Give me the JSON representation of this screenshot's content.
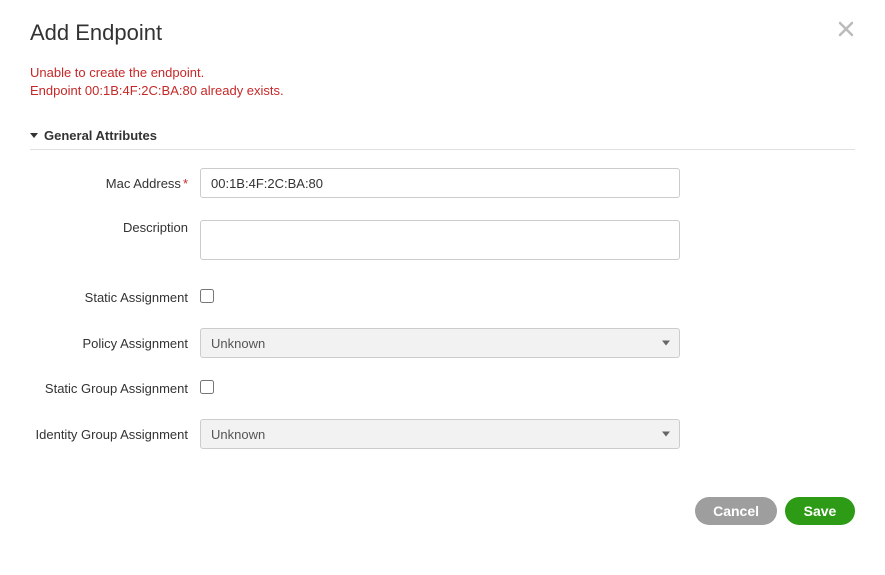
{
  "dialog": {
    "title": "Add Endpoint"
  },
  "error": {
    "line1": "Unable to create the endpoint.",
    "line2": "Endpoint 00:1B:4F:2C:BA:80 already exists."
  },
  "section": {
    "general_attributes": "General Attributes"
  },
  "labels": {
    "mac_address": "Mac Address",
    "description": "Description",
    "static_assignment": "Static Assignment",
    "policy_assignment": "Policy Assignment",
    "static_group_assignment": "Static Group Assignment",
    "identity_group_assignment": "Identity Group Assignment"
  },
  "values": {
    "mac_address": "00:1B:4F:2C:BA:80",
    "description": "",
    "static_assignment_checked": false,
    "policy_assignment": "Unknown",
    "static_group_assignment_checked": false,
    "identity_group_assignment": "Unknown"
  },
  "buttons": {
    "cancel": "Cancel",
    "save": "Save"
  }
}
